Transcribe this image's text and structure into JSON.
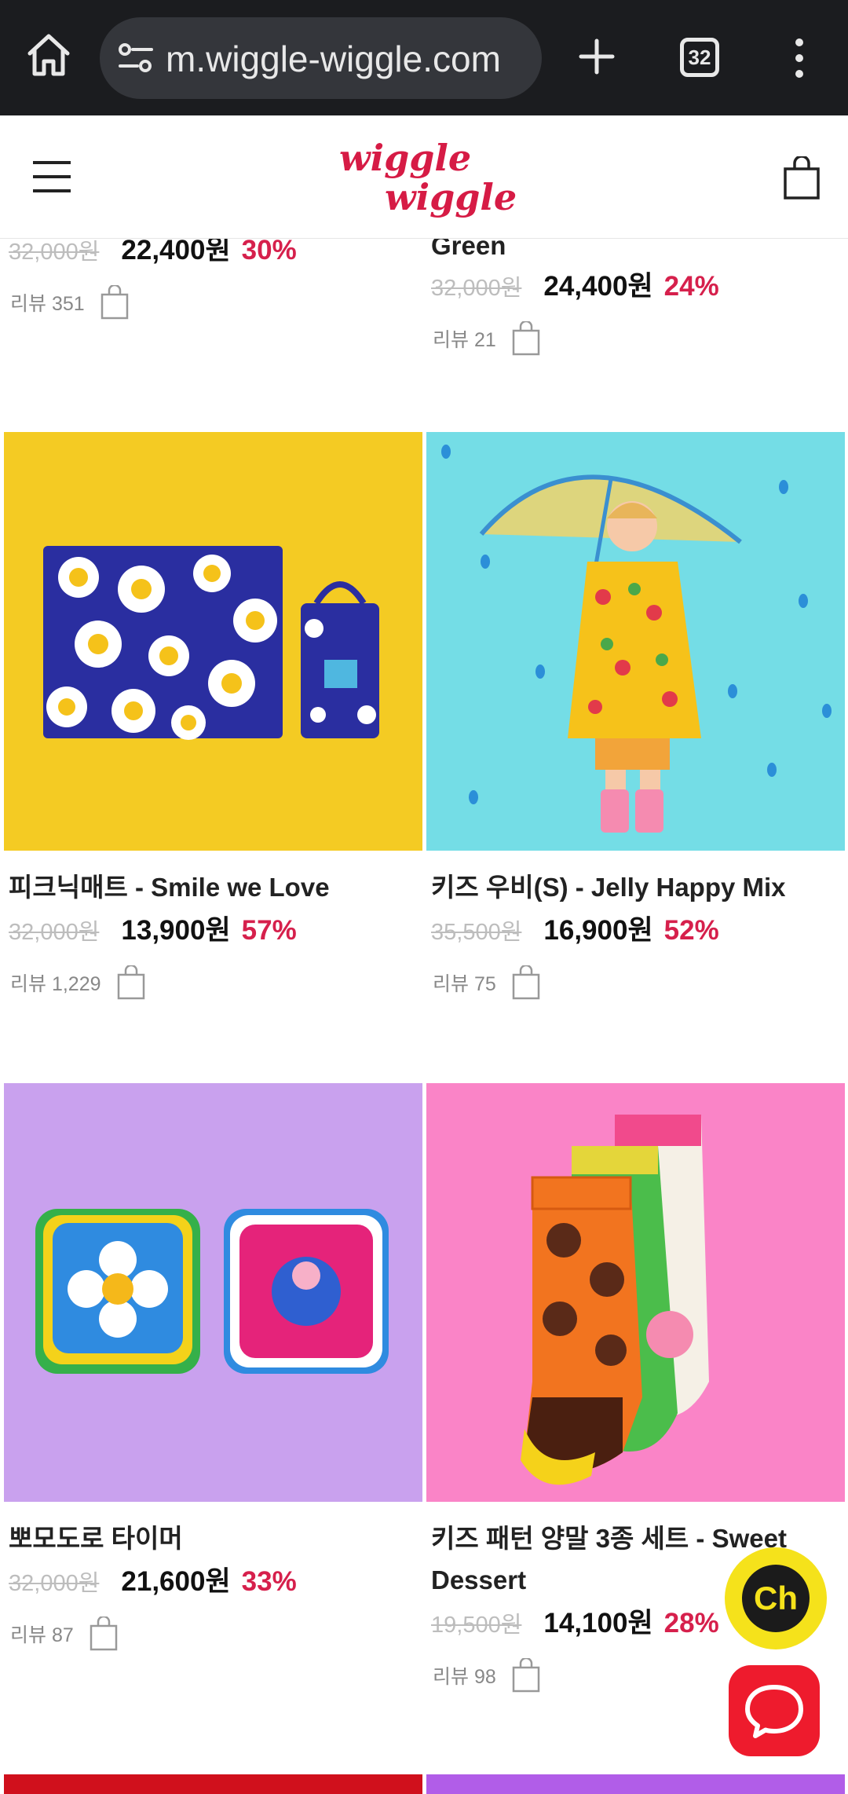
{
  "browser": {
    "url": "m.wiggle-wiggle.com",
    "tab_count": "32"
  },
  "site": {
    "logo_line1": "wiggle",
    "logo_line2": "wiggle"
  },
  "products_top": [
    {
      "name": "",
      "orig_price": "32,000원",
      "sale_price": "22,400원",
      "discount": "30%",
      "reviews": "리뷰 351"
    },
    {
      "name": "Green",
      "orig_price": "32,000원",
      "sale_price": "24,400원",
      "discount": "24%",
      "reviews": "리뷰 21"
    }
  ],
  "products_row2": [
    {
      "name": "피크닉매트 - Smile we Love",
      "orig_price": "32,000원",
      "sale_price": "13,900원",
      "discount": "57%",
      "reviews": "리뷰 1,229",
      "bg": "#f4cb23"
    },
    {
      "name": "키즈 우비(S) - Jelly Happy Mix",
      "orig_price": "35,500원",
      "sale_price": "16,900원",
      "discount": "52%",
      "reviews": "리뷰 75",
      "bg": "#74dde6"
    }
  ],
  "products_row3": [
    {
      "name": "뽀모도로 타이머",
      "orig_price": "32,000원",
      "sale_price": "21,600원",
      "discount": "33%",
      "reviews": "리뷰 87",
      "bg": "#c9a1ee"
    },
    {
      "name_line1": "키즈 패턴 양말 3종 세트 - Sweet",
      "name_line2": "Dessert",
      "orig_price": "19,500원",
      "sale_price": "14,100원",
      "discount": "28%",
      "reviews": "리뷰 98",
      "bg": "#fa84c7"
    }
  ],
  "floating": {
    "chat_label": "Ch"
  },
  "colors": {
    "discount": "#d6204c",
    "brand_red": "#d61b45",
    "chat_yellow": "#f5e21b",
    "talk_red": "#ee1b2d"
  },
  "icons": [
    "home-icon",
    "site-settings-icon",
    "new-tab-icon",
    "tab-switcher-icon",
    "more-menu-icon",
    "hamburger-menu-icon",
    "shopping-bag-icon",
    "cart-add-icon",
    "chat-bubble-icon"
  ]
}
